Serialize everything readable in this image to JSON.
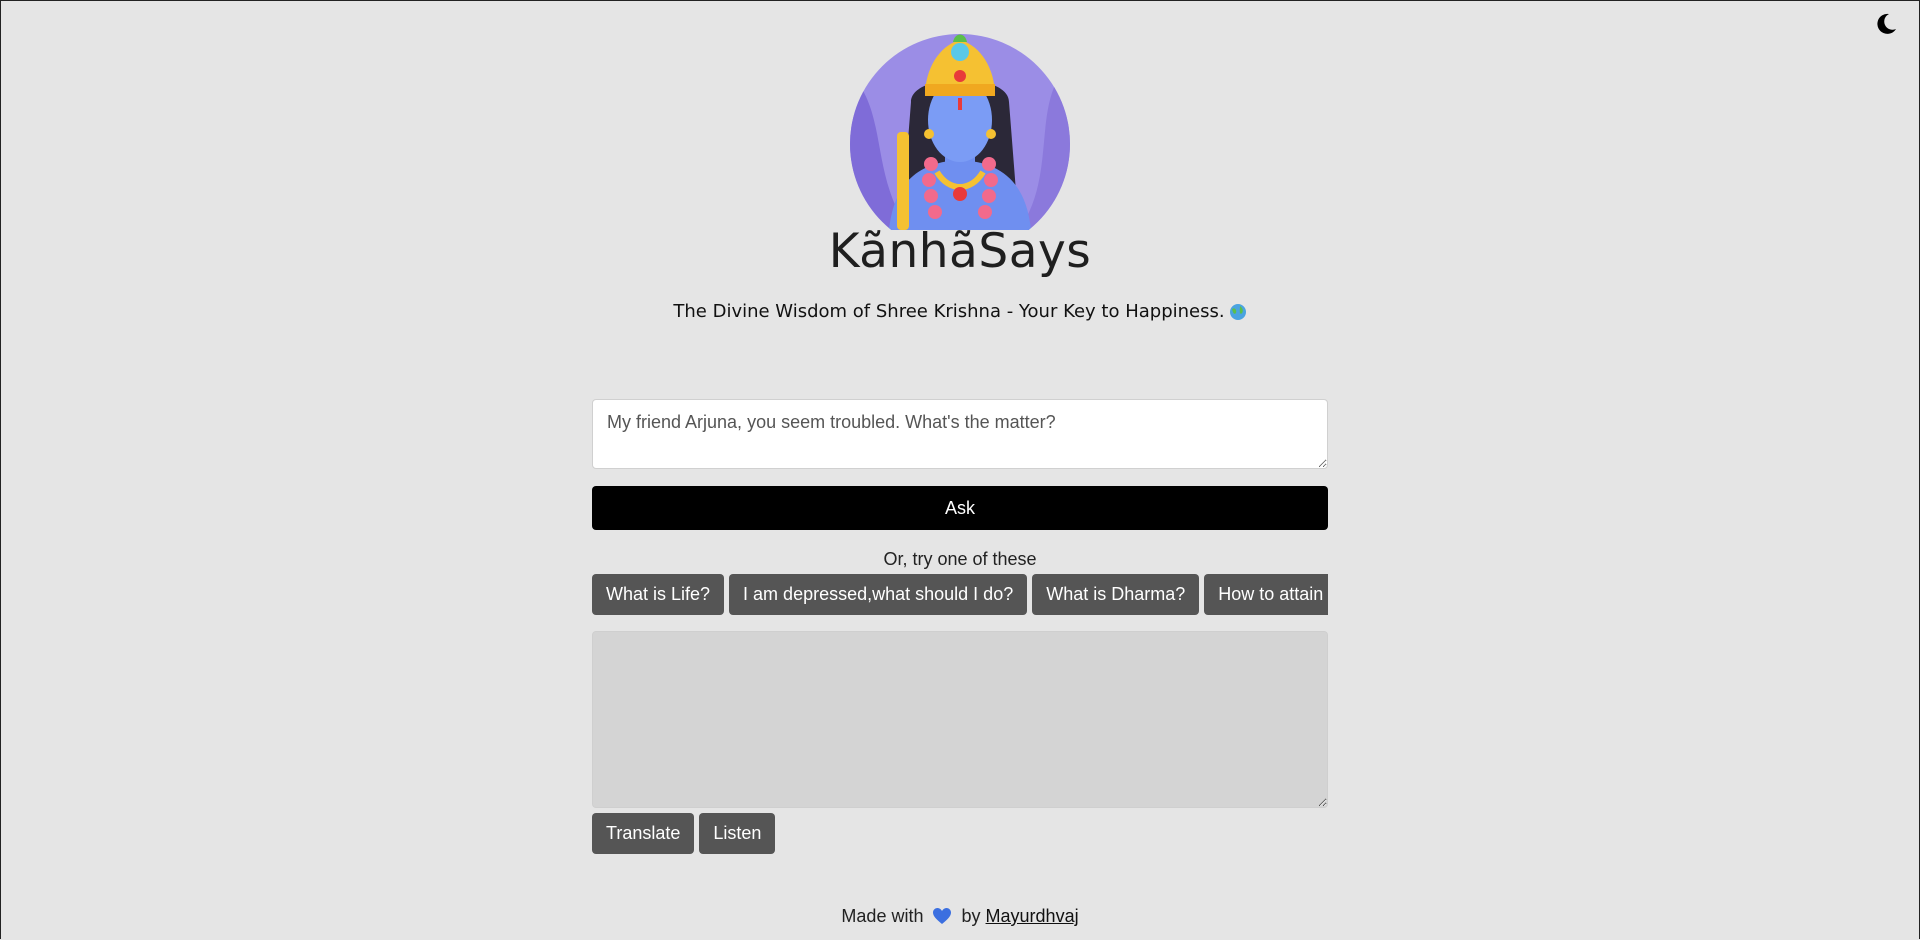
{
  "header": {
    "title": "KãnhãSays",
    "tagline": "The Divine Wisdom of Shree Krishna - Your Key to Happiness.",
    "tagline_icon": "globe-icon",
    "avatar_icon": "krishna-avatar"
  },
  "theme_toggle": {
    "icon": "moon-icon"
  },
  "ask": {
    "placeholder": "My friend Arjuna, you seem troubled. What's the matter?",
    "button_label": "Ask"
  },
  "suggestions": {
    "label": "Or, try one of these",
    "items": [
      {
        "label": "What is Life?"
      },
      {
        "label": "I am depressed,what should I do?"
      },
      {
        "label": "What is Dharma?"
      },
      {
        "label": "How to attain"
      }
    ]
  },
  "answer": {
    "value": ""
  },
  "actions": {
    "translate_label": "Translate",
    "listen_label": "Listen"
  },
  "footer": {
    "made_with": "Made with",
    "heart_icon": "blue-heart-icon",
    "by": "by",
    "author": "Mayurdhvaj"
  },
  "colors": {
    "background": "#e5e5e5",
    "ask_button": "#000000",
    "chip": "#555555",
    "answer_bg": "#d4d4d4",
    "avatar_circle": "#8f7fe0"
  }
}
